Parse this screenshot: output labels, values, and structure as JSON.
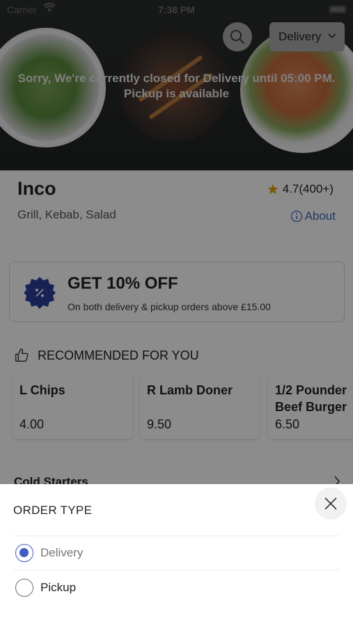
{
  "status_bar": {
    "carrier": "Carrier",
    "time": "7:38 PM"
  },
  "header": {
    "delivery_button_label": "Delivery",
    "closed_line1": "Sorry, We're currently closed for Delivery until 05:00 PM.",
    "closed_line2": "Pickup is available"
  },
  "restaurant": {
    "name": "Inco",
    "rating": "4.7(400+)",
    "cuisine": "Grill, Kebab, Salad",
    "about_label": "About"
  },
  "offer": {
    "title": "GET 10% OFF",
    "subtitle": "On both delivery & pickup orders above £15.00"
  },
  "recommended": {
    "title": "RECOMMENDED FOR YOU",
    "items": [
      {
        "name": "L Chips",
        "price": "4.00"
      },
      {
        "name": "R Lamb Doner",
        "price": "9.50"
      },
      {
        "name": "1/2 Pounder Beef Burger",
        "name_line1": "1/2 Pounder",
        "name_line2": "Beef Burger",
        "price": "6.50"
      }
    ]
  },
  "sections": [
    {
      "label": "Cold Starters"
    }
  ],
  "order_type_sheet": {
    "title": "ORDER TYPE",
    "options": [
      {
        "label": "Delivery",
        "selected": true
      },
      {
        "label": "Pickup",
        "selected": false
      }
    ]
  },
  "colors": {
    "accent": "#3f5bc5",
    "link": "#3a6bb5",
    "star": "#e3a21a"
  },
  "icons": [
    "search-icon",
    "chevron-down-icon",
    "star-icon",
    "info-icon",
    "discount-badge-icon",
    "thumbs-up-icon",
    "chevron-right-icon",
    "close-icon"
  ]
}
